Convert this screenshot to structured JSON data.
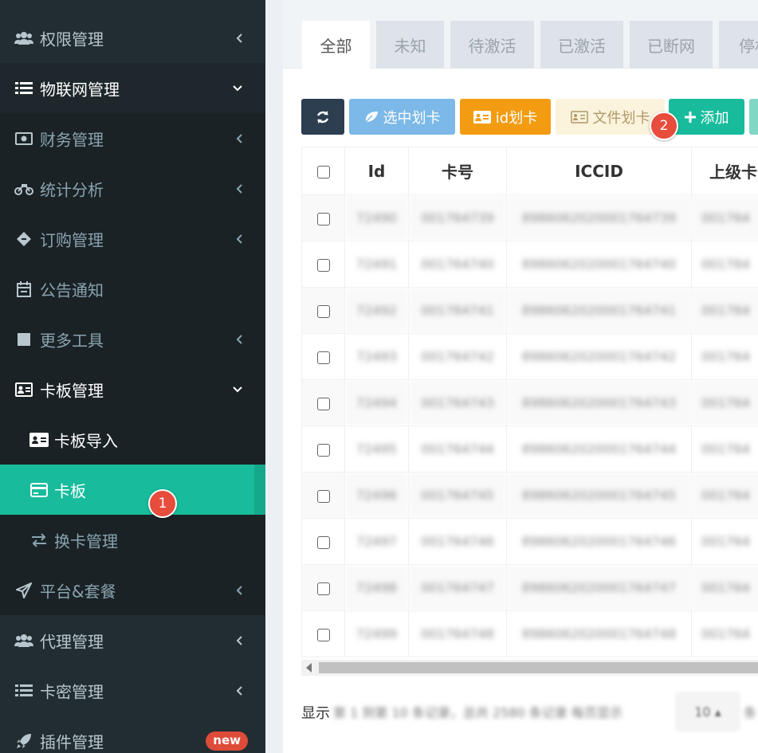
{
  "sidebar": {
    "items": [
      {
        "label": "权限管理",
        "icon": "users-icon"
      },
      {
        "label": "物联网管理",
        "icon": "list-icon"
      },
      {
        "label": "财务管理",
        "icon": "money-icon"
      },
      {
        "label": "统计分析",
        "icon": "motorcycle-icon"
      },
      {
        "label": "订购管理",
        "icon": "ticket-icon"
      },
      {
        "label": "公告通知",
        "icon": "calendar-icon"
      },
      {
        "label": "更多工具",
        "icon": "square-icon"
      },
      {
        "label": "卡板管理",
        "icon": "id-card-icon"
      },
      {
        "label": "平台&套餐",
        "icon": "paper-plane-icon"
      },
      {
        "label": "代理管理",
        "icon": "users-icon"
      },
      {
        "label": "卡密管理",
        "icon": "list-icon"
      },
      {
        "label": "插件管理",
        "icon": "rocket-icon"
      }
    ],
    "submenu": [
      {
        "label": "卡板导入",
        "icon": "id-card-icon"
      },
      {
        "label": "卡板",
        "icon": "credit-card-icon"
      },
      {
        "label": "换卡管理",
        "icon": "exchange-icon"
      }
    ],
    "new_badge": "new"
  },
  "steps": {
    "one": "1",
    "two": "2"
  },
  "tabs": [
    "全部",
    "未知",
    "待激活",
    "已激活",
    "已断网",
    "停机"
  ],
  "toolbar": {
    "select_assign": "选中划卡",
    "id_assign": "id划卡",
    "file_assign": "文件划卡",
    "add": "添加"
  },
  "colors": {
    "sidebar_bg": "#222d32",
    "active_green": "#18bc9c",
    "refresh_btn": "#2c3e50",
    "info_btn": "#7cb9e8",
    "warning_btn": "#f39c12",
    "file_btn": "#fbf3dc",
    "success_btn": "#18bc9c",
    "badge_red": "#dd4b39"
  },
  "table": {
    "headers": [
      "Id",
      "卡号",
      "ICCID",
      "上级卡号"
    ],
    "rows": [
      [
        "72490",
        "001764739",
        "8986062020001764739",
        "001764"
      ],
      [
        "72491",
        "001764740",
        "8986062020001764740",
        "001764"
      ],
      [
        "72492",
        "001764741",
        "8986062020001764741",
        "001764"
      ],
      [
        "72493",
        "001764742",
        "8986062020001764742",
        "001764"
      ],
      [
        "72494",
        "001764743",
        "8986062020001764743",
        "001764"
      ],
      [
        "72495",
        "001764744",
        "8986062020001764744",
        "001764"
      ],
      [
        "72496",
        "001764745",
        "8986062020001764745",
        "001764"
      ],
      [
        "72497",
        "001764746",
        "8986062020001764746",
        "001764"
      ],
      [
        "72498",
        "001764747",
        "8986062020001764747",
        "001764"
      ],
      [
        "72499",
        "001764748",
        "8986062020001764748",
        "001764"
      ]
    ]
  },
  "footer": {
    "prefix": "显示",
    "info": "第 1 到第 10 条记录，总共 2580 条记录 每页显示",
    "page_size": "10",
    "suffix": "条"
  }
}
